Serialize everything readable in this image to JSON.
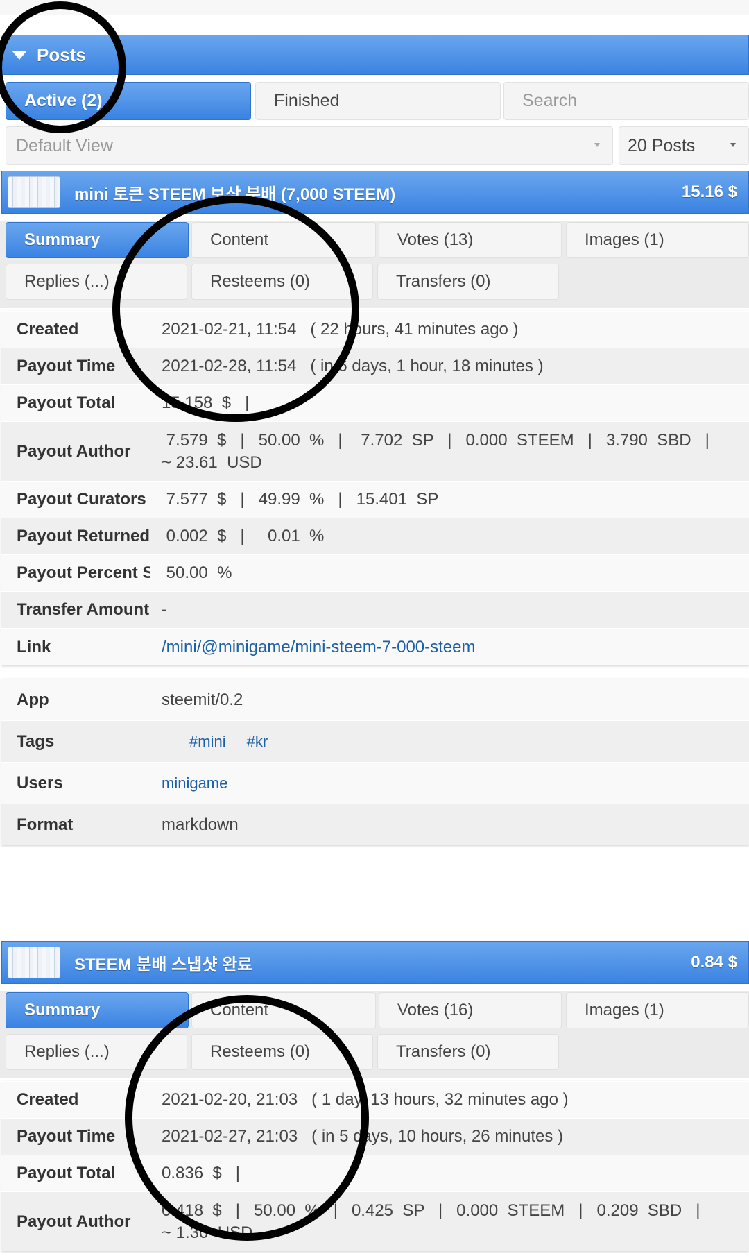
{
  "posts_section": {
    "title": "Posts"
  },
  "filters": {
    "active_label": "Active (2)",
    "finished_label": "Finished",
    "search_placeholder": "Search",
    "view_select": "Default View",
    "count_select": "20 Posts"
  },
  "posts": [
    {
      "title": "mini 토큰 STEEM 보상 분배 (7,000 STEEM)",
      "amount": "15.16 $",
      "tabs": {
        "summary": "Summary",
        "content": "Content",
        "votes": "Votes (13)",
        "images": "Images (1)",
        "replies": "Replies (...)",
        "resteems": "Resteems (0)",
        "transfers": "Transfers (0)"
      },
      "details": {
        "created_label": "Created",
        "created": "2021-02-21, 11:54   ( 22 hours, 41 minutes ago )",
        "payout_time_label": "Payout Time",
        "payout_time": "2021-02-28, 11:54   ( in 6 days, 1 hour, 18 minutes )",
        "payout_total_label": "Payout Total",
        "payout_total": "15.158  $   |",
        "payout_author_label": "Payout Author",
        "payout_author": " 7.579  $   |   50.00  %   |    7.702  SP   |   0.000  STEEM   |   3.790  SBD   |\n~ 23.61  USD",
        "payout_curators_label": "Payout Curators",
        "payout_curators": " 7.577  $   |   49.99  %   |   15.401  SP",
        "payout_returned_label": "Payout Returned",
        "payout_returned": " 0.002  $   |     0.01  %",
        "payout_percent_label": "Payout Percent SBD",
        "payout_percent": " 50.00  %",
        "transfer_amount_label": "Transfer Amount",
        "transfer_amount": "-",
        "link_label": "Link",
        "link": "/mini/@minigame/mini-steem-7-000-steem"
      },
      "meta": {
        "app_label": "App",
        "app": "steemit/0.2",
        "tags_label": "Tags",
        "tags": [
          "#mini",
          "#kr"
        ],
        "users_label": "Users",
        "users": "minigame",
        "format_label": "Format",
        "format": "markdown"
      }
    },
    {
      "title": "STEEM 분배 스냅샷 완료",
      "amount": "0.84 $",
      "tabs": {
        "summary": "Summary",
        "content": "Content",
        "votes": "Votes (16)",
        "images": "Images (1)",
        "replies": "Replies (...)",
        "resteems": "Resteems (0)",
        "transfers": "Transfers (0)"
      },
      "details": {
        "created_label": "Created",
        "created": "2021-02-20, 21:03   ( 1 day, 13 hours, 32 minutes ago )",
        "payout_time_label": "Payout Time",
        "payout_time": "2021-02-27, 21:03   ( in 5 days, 10 hours, 26 minutes )",
        "payout_total_label": "Payout Total",
        "payout_total": "0.836  $   |",
        "payout_author_label": "Payout Author",
        "payout_author": "0.418  $   |   50.00  %   |   0.425  SP   |   0.000  STEEM   |   0.209  SBD   |\n~ 1.30  USD"
      }
    }
  ]
}
